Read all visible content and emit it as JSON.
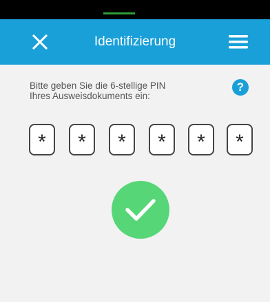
{
  "header": {
    "title": "Identifizierung",
    "close_icon": "close-icon",
    "menu_icon": "hamburger-menu-icon",
    "background_color": "#1aa0d8"
  },
  "instruction": {
    "line1": "Bitte geben Sie die 6-stellige PIN",
    "line2": "Ihres Ausweisdokuments ein:",
    "help_label": "?"
  },
  "pin": {
    "length": 6,
    "digits": [
      "*",
      "*",
      "*",
      "*",
      "*",
      "*"
    ]
  },
  "status": {
    "icon": "checkmark-icon",
    "color": "#56d676"
  }
}
